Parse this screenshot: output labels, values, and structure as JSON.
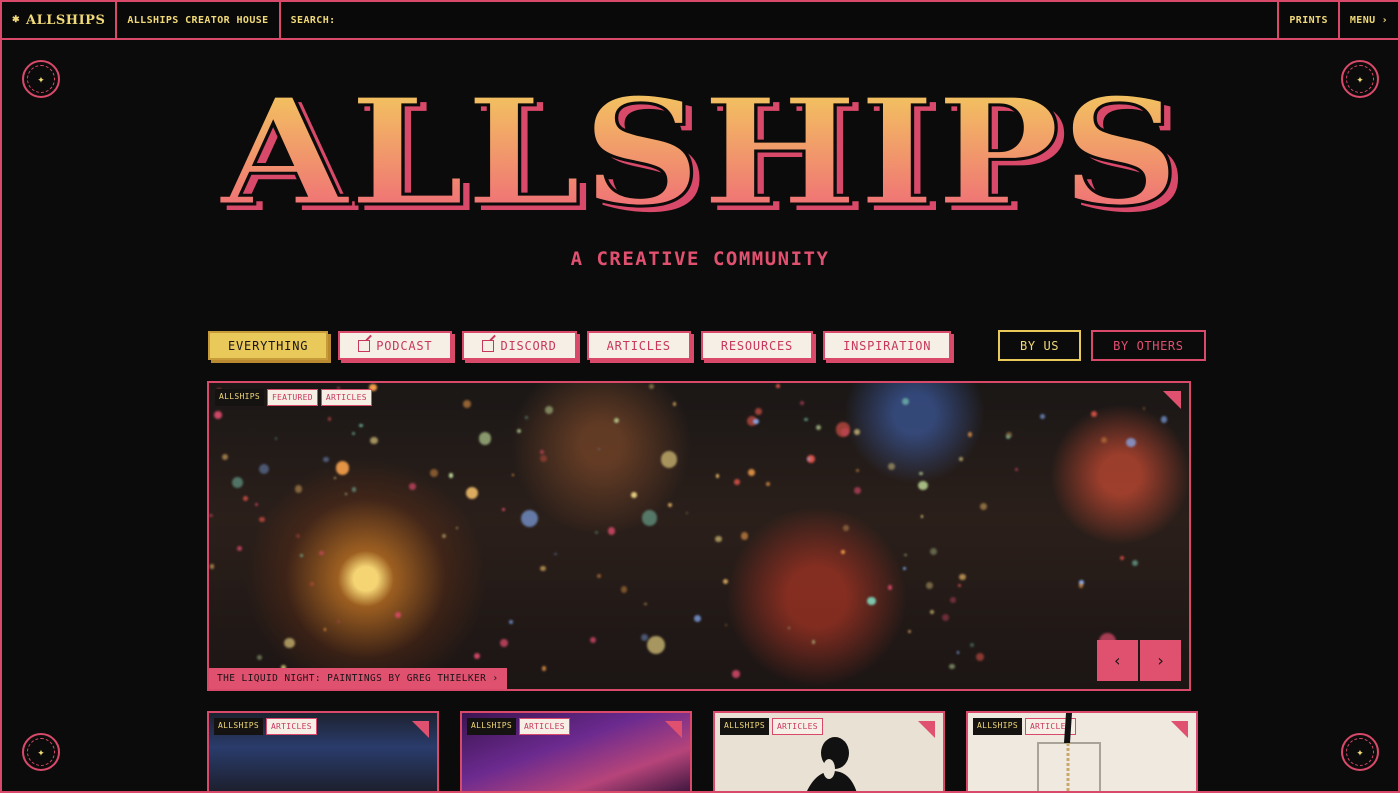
{
  "topbar": {
    "brand": "ALLSHIPS",
    "brand_symbol": "✱",
    "creator_house": "ALLSHIPS CREATOR HOUSE",
    "search_label": "SEARCH:",
    "search_value": "",
    "prints": "PRINTS",
    "menu": "MENU",
    "menu_icon": "chevron-right-icon"
  },
  "hero": {
    "wordmark": "ALLSHIPS",
    "tagline": "A CREATIVE COMMUNITY"
  },
  "filters": {
    "items": [
      {
        "label": "EVERYTHING",
        "active": true,
        "external": false
      },
      {
        "label": "PODCAST",
        "active": false,
        "external": true
      },
      {
        "label": "DISCORD",
        "active": false,
        "external": true
      },
      {
        "label": "ARTICLES",
        "active": false,
        "external": false
      },
      {
        "label": "RESOURCES",
        "active": false,
        "external": false
      },
      {
        "label": "INSPIRATION",
        "active": false,
        "external": false
      }
    ],
    "by_us": "BY US",
    "by_others": "BY OTHERS"
  },
  "featured": {
    "tags": [
      "ALLSHIPS",
      "FEATURED",
      "ARTICLES"
    ],
    "caption": "THE LIQUID NIGHT: PAINTINGS BY GREG THIELKER ›",
    "prev": "‹",
    "next": "›"
  },
  "cards": [
    {
      "tags": [
        "ALLSHIPS",
        "ARTICLES"
      ]
    },
    {
      "tags": [
        "ALLSHIPS",
        "ARTICLES"
      ]
    },
    {
      "tags": [
        "ALLSHIPS",
        "ARTICLES"
      ]
    },
    {
      "tags": [
        "ALLSHIPS",
        "ARTICLES"
      ]
    }
  ],
  "colors": {
    "background": "#0c0b0b",
    "accent_pink": "#d94a6a",
    "accent_yellow": "#f0d978"
  }
}
